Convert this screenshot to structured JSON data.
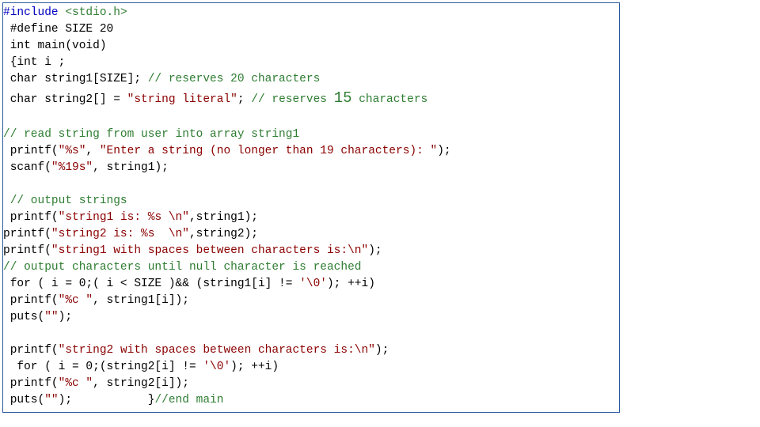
{
  "code": {
    "include_kw": "#include",
    "include_hdr": " <stdio.h>",
    "l02": " #define SIZE 20",
    "l03": " int main(void)",
    "l04": " {int i ;",
    "l05a": " char string1[SIZE]; ",
    "l05b": "// reserves 20 characters",
    "l06a": " char string2[] = ",
    "l06s": "\"string literal\"",
    "l06b": "; ",
    "l06c1": "// reserves ",
    "l06num": "15",
    "l06c2": " characters",
    "l07": "",
    "l08": "// read string from user into array string1",
    "l09a": " printf(",
    "l09s1": "\"%s\"",
    "l09b": ", ",
    "l09s2": "\"Enter a string (no longer than 19 characters): \"",
    "l09c": ");",
    "l10a": " scanf(",
    "l10s": "\"%19s\"",
    "l10b": ", string1);",
    "l11": "",
    "l12a": " ",
    "l12b": "// output strings",
    "l13a": " printf(",
    "l13s": "\"string1 is: %s \\n\"",
    "l13b": ",string1);",
    "l14a": "printf(",
    "l14s": "\"string2 is: %s  \\n\"",
    "l14b": ",string2);",
    "l15a": "printf(",
    "l15s": "\"string1 with spaces between characters is:\\n\"",
    "l15b": ");",
    "l16": "// output characters until null character is reached",
    "l17a": " for ( i = 0;( i < SIZE )&& (string1[i] != ",
    "l17s": "'\\0'",
    "l17b": "); ++i)",
    "l18a": " printf(",
    "l18s": "\"%c \"",
    "l18b": ", string1[i]);",
    "l19a": " puts(",
    "l19s": "\"\"",
    "l19b": ");",
    "l20": "",
    "l21a": " printf(",
    "l21s": "\"string2 with spaces between characters is:\\n\"",
    "l21b": ");",
    "l22a": "  for ( i = 0;(string2[i] != ",
    "l22s": "'\\0'",
    "l22b": "); ++i)",
    "l23a": " printf(",
    "l23s": "\"%c \"",
    "l23b": ", string2[i]);",
    "l24a": " puts(",
    "l24s": "\"\"",
    "l24b": ");           }",
    "l24c": "//end main"
  }
}
